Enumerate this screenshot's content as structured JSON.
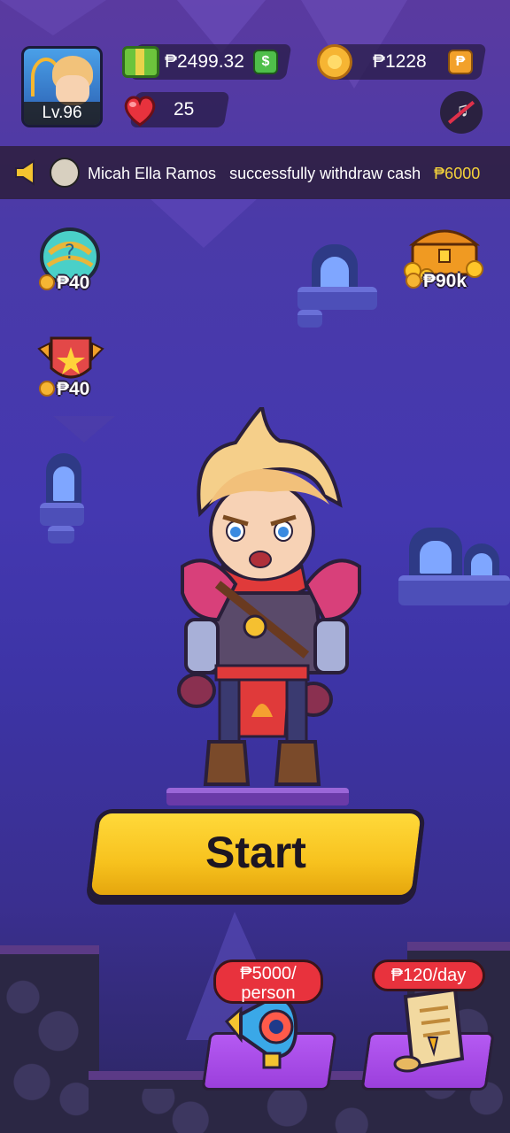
{
  "player": {
    "level_label": "Lv.96"
  },
  "currency": {
    "cash": "₱2499.32",
    "coins": "₱1228",
    "lives": "25",
    "cash_button_symbol": "$",
    "coin_button_symbol": "₱"
  },
  "notice": {
    "name": "Micah Ella Ramos",
    "message": "successfully withdraw cash",
    "amount": "₱6000"
  },
  "side_items": {
    "egg_price": "₱40",
    "shield_price": "₱40",
    "chest_price": "₱90k"
  },
  "start_button": {
    "label": "Start"
  },
  "bottom": {
    "invite_reward": "₱5000/",
    "invite_reward_unit": "person",
    "daily_reward": "₱120/day"
  },
  "icons": {
    "avatar": "hero-avatar-icon",
    "cash": "cash-icon",
    "coin": "coin-icon",
    "heart": "heart-icon",
    "music": "music-muted-icon",
    "speaker": "speaker-icon",
    "egg": "egg-icon",
    "shield": "shield-icon",
    "chest": "treasure-chest-icon",
    "megaphone": "megaphone-icon",
    "scroll": "scroll-icon"
  },
  "colors": {
    "accent_yellow": "#f7c21e",
    "notice_amount": "#f4d23a",
    "bubble_red": "#e8323d",
    "card_purple": "#a84ae6"
  }
}
